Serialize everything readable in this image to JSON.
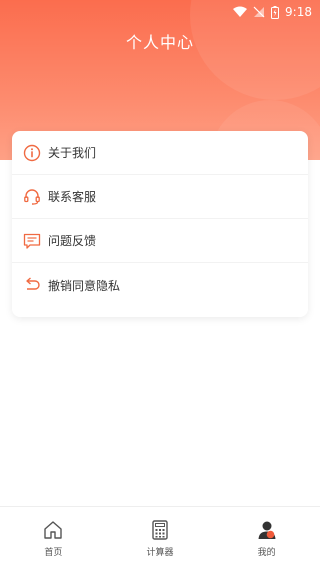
{
  "status_bar": {
    "time": "9:18"
  },
  "header": {
    "title": "个人中心"
  },
  "menu": [
    {
      "label": "关于我们",
      "icon": "info-icon"
    },
    {
      "label": "联系客服",
      "icon": "headset-icon"
    },
    {
      "label": "问题反馈",
      "icon": "feedback-icon"
    },
    {
      "label": "撤销同意隐私",
      "icon": "undo-icon"
    }
  ],
  "tabbar": [
    {
      "label": "首页",
      "icon": "home-icon"
    },
    {
      "label": "计算器",
      "icon": "calculator-icon"
    },
    {
      "label": "我的",
      "icon": "user-icon",
      "active": true
    }
  ],
  "colors": {
    "accent": "#fb6d4e",
    "icon_orange": "#f06a42",
    "text": "#333333"
  }
}
